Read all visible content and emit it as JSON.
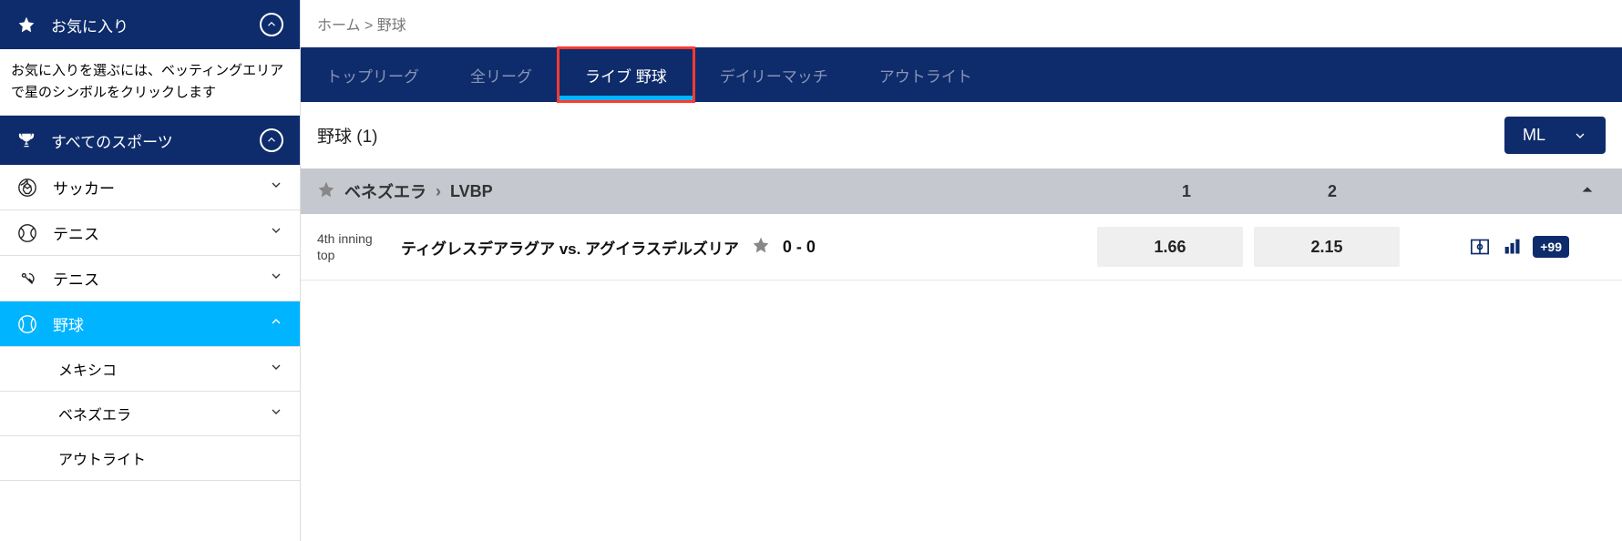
{
  "sidebar": {
    "favorites": {
      "label": "お気に入り"
    },
    "fav_hint": "お気に入りを選ぶには、ベッティングエリアで星のシンボルをクリックします",
    "all_sports": {
      "label": "すべてのスポーツ"
    },
    "sports": [
      {
        "label": "サッカー",
        "icon": "soccer"
      },
      {
        "label": "テニス",
        "icon": "tennis"
      },
      {
        "label": "テニス",
        "icon": "tabletennis"
      },
      {
        "label": "野球",
        "icon": "baseball",
        "active": true
      }
    ],
    "sub_items": [
      {
        "label": "メキシコ"
      },
      {
        "label": "ベネズエラ"
      },
      {
        "label": "アウトライト"
      }
    ]
  },
  "breadcrumb": {
    "home": "ホーム",
    "sep": ">",
    "current": "野球"
  },
  "tabs": [
    {
      "label": "トップリーグ"
    },
    {
      "label": "全リーグ"
    },
    {
      "label": "ライブ 野球",
      "active": true,
      "highlighted": true
    },
    {
      "label": "デイリーマッチ"
    },
    {
      "label": "アウトライト"
    }
  ],
  "section": {
    "title": "野球 (1)",
    "select_label": "ML"
  },
  "league": {
    "country": "ベネズエラ",
    "name": "LVBP",
    "cols": [
      "1",
      "2"
    ]
  },
  "match": {
    "time_line1": "4th inning",
    "time_line2": "top",
    "name": "ティグレスデアラグア vs. アグイラスデルズリア",
    "score": "0 - 0",
    "odds": [
      "1.66",
      "2.15"
    ],
    "more": "+99"
  }
}
